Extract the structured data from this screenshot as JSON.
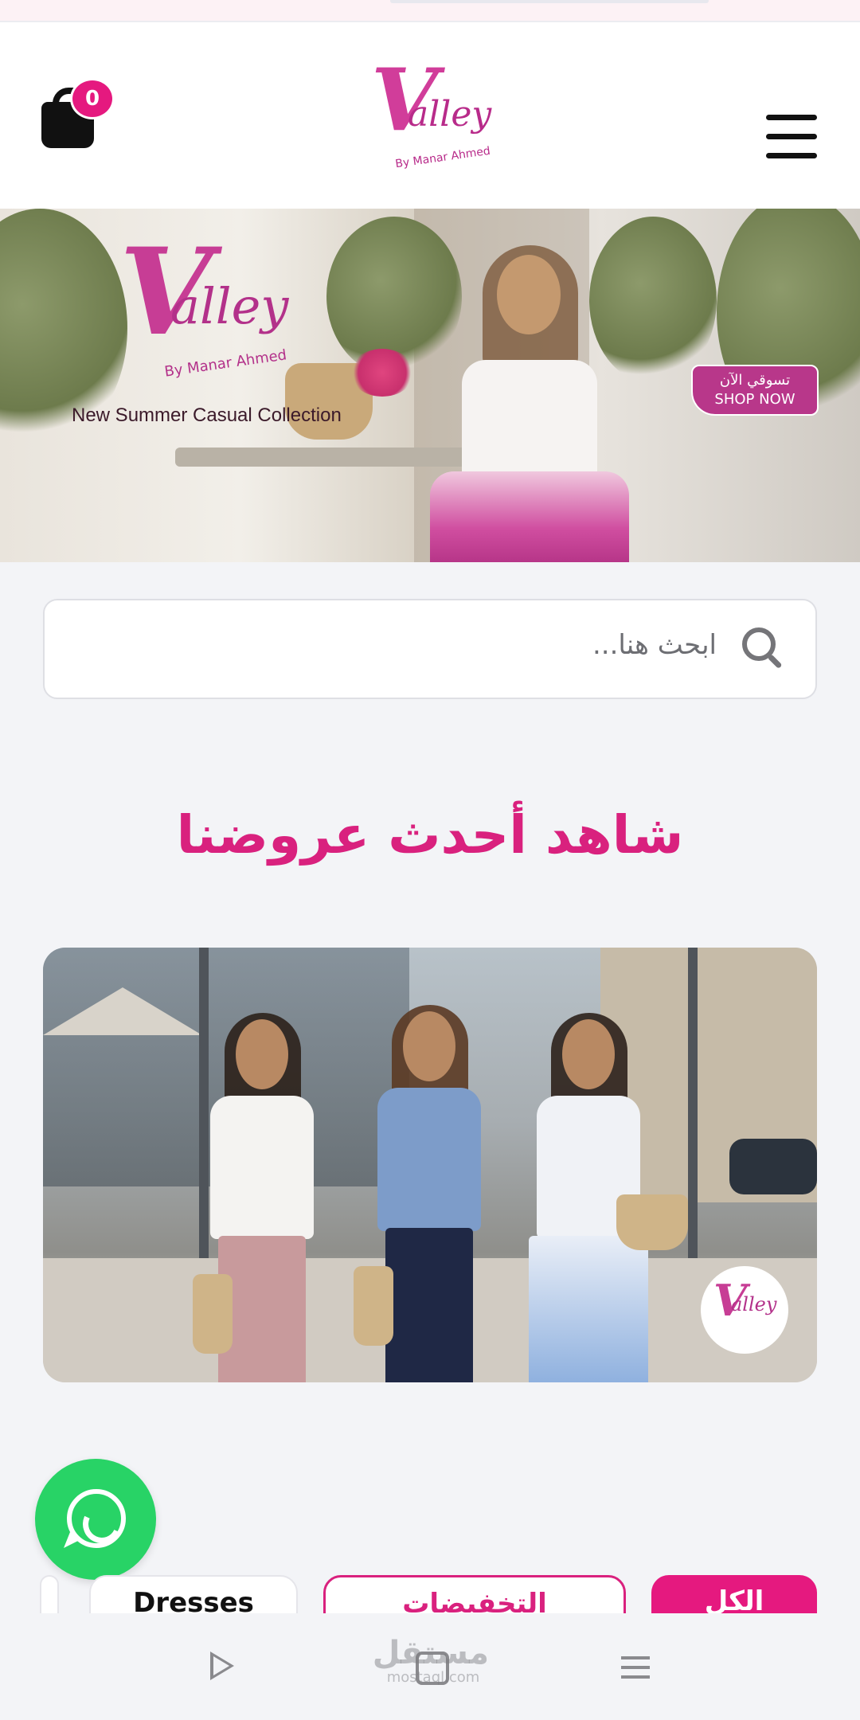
{
  "header": {
    "cart_count": "0",
    "logo": {
      "mark": "V",
      "word": "alley",
      "byline": "By Manar Ahmed"
    }
  },
  "hero": {
    "logo": {
      "mark": "V",
      "word": "alley",
      "byline": "By Manar Ahmed"
    },
    "tagline": "New Summer Casual Collection",
    "shop_now_ar": "تسوقي الآن",
    "shop_now_en": "SHOP NOW"
  },
  "search": {
    "placeholder": "ابحث هنا..."
  },
  "offers": {
    "title": "شاهد أحدث عروضنا",
    "badge": {
      "mark": "V",
      "word": "alley"
    }
  },
  "categories": {
    "items": [
      {
        "label": ""
      },
      {
        "label": "Dresses"
      },
      {
        "label": "التخفيضات"
      },
      {
        "label": "الكل"
      }
    ]
  },
  "watermark": {
    "ar": "مستقل",
    "en": "mostaql.com"
  },
  "colors": {
    "brand_pink": "#e5197f",
    "title_pink": "#d9217e",
    "whatsapp_green": "#28d366"
  },
  "icons": {
    "cart": "shopping-bag-icon",
    "menu": "hamburger-menu-icon",
    "search": "search-icon",
    "whatsapp": "whatsapp-icon",
    "nav_back": "play-triangle-icon",
    "nav_home": "square-home-icon",
    "nav_recent": "recent-apps-icon"
  }
}
